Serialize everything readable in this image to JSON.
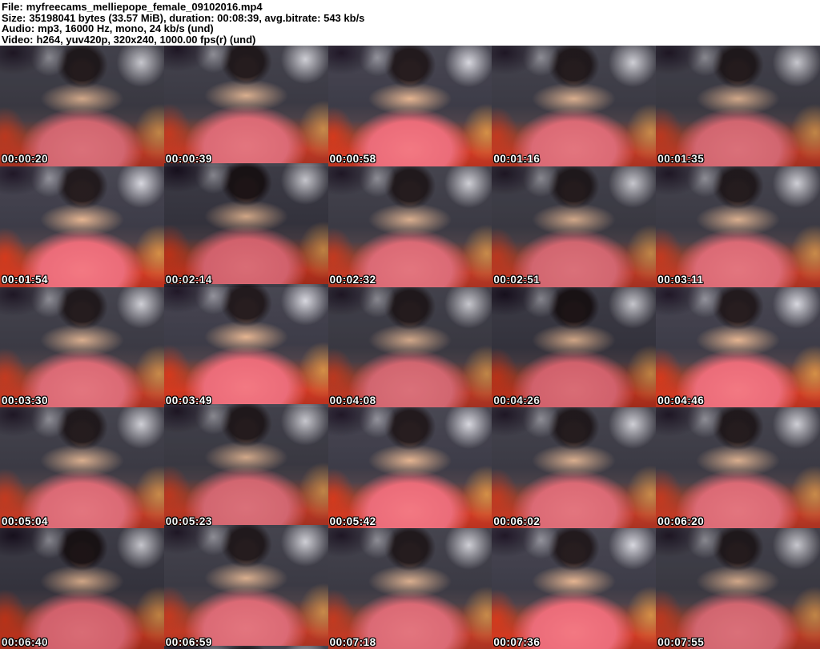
{
  "header": {
    "lines": [
      {
        "label": "File:",
        "value": "myfreecams_melliepope_female_09102016.mp4"
      },
      {
        "label": "Size:",
        "value": "35198041 bytes (33.57 MiB), duration: 00:08:39, avg.bitrate: 543 kb/s"
      },
      {
        "label": "Audio:",
        "value": "mp3, 16000 Hz, mono, 24 kb/s (und)"
      },
      {
        "label": "Video:",
        "value": "h264, yuv420p, 320x240, 1000.00 fps(r) (und)"
      }
    ]
  },
  "grid": {
    "columns": 5,
    "rows": 5,
    "tiles": [
      {
        "timestamp": "00:00:20"
      },
      {
        "timestamp": "00:00:39"
      },
      {
        "timestamp": "00:00:58"
      },
      {
        "timestamp": "00:01:16"
      },
      {
        "timestamp": "00:01:35"
      },
      {
        "timestamp": "00:01:54"
      },
      {
        "timestamp": "00:02:14"
      },
      {
        "timestamp": "00:02:32"
      },
      {
        "timestamp": "00:02:51"
      },
      {
        "timestamp": "00:03:11"
      },
      {
        "timestamp": "00:03:30"
      },
      {
        "timestamp": "00:03:49"
      },
      {
        "timestamp": "00:04:08"
      },
      {
        "timestamp": "00:04:26"
      },
      {
        "timestamp": "00:04:46"
      },
      {
        "timestamp": "00:05:04"
      },
      {
        "timestamp": "00:05:23"
      },
      {
        "timestamp": "00:05:42"
      },
      {
        "timestamp": "00:06:02"
      },
      {
        "timestamp": "00:06:20"
      },
      {
        "timestamp": "00:06:40"
      },
      {
        "timestamp": "00:06:59"
      },
      {
        "timestamp": "00:07:18"
      },
      {
        "timestamp": "00:07:36"
      },
      {
        "timestamp": "00:07:55"
      }
    ]
  },
  "colors": {
    "header_background": "#ffffff",
    "header_text": "#000000",
    "wall_dark": "#3a3941",
    "couch_red": "#c03a26",
    "cushion_stripe_orange": "#c88a4a",
    "blouse_pink": "#db6a75",
    "timestamp_text": "#ffffff",
    "timestamp_outline": "#000000"
  }
}
